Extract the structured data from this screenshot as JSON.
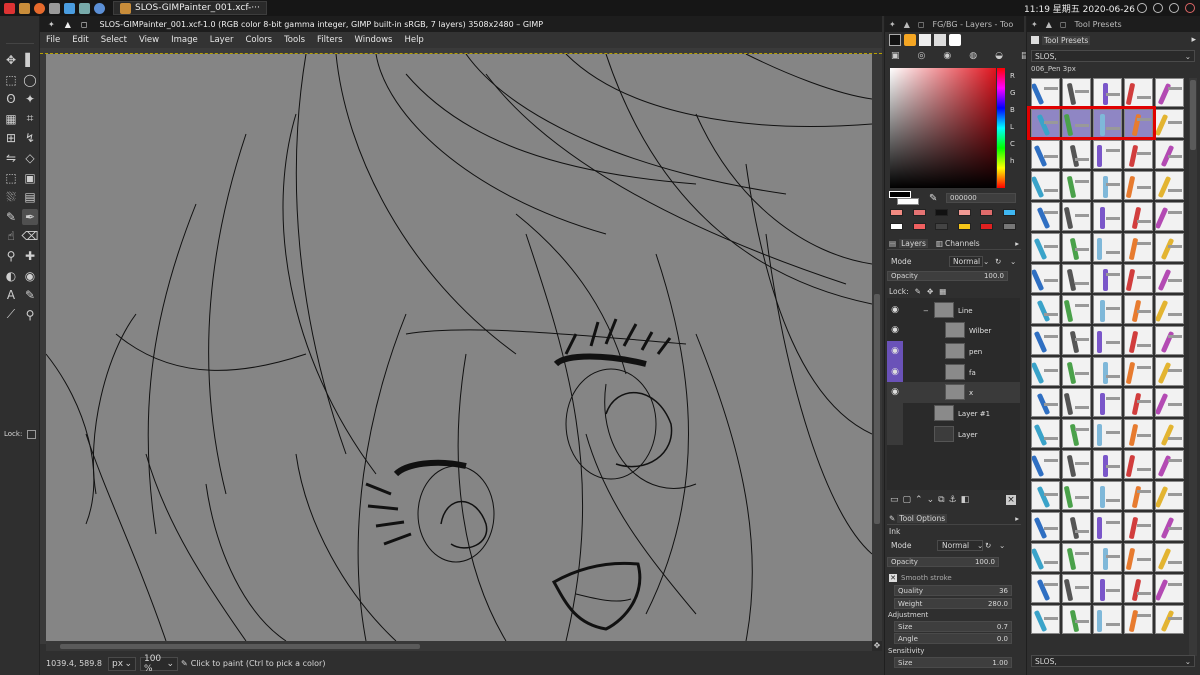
{
  "taskbar": {
    "window_button": "SLOS-GIMPainter_001.xcf-···",
    "clock": "11:19 星期五 2020-06-26"
  },
  "image_window": {
    "title": "SLOS-GIMPainter_001.xcf-1.0 (RGB color 8-bit gamma integer, GIMP built-in sRGB, 7 layers) 3508x2480 – GIMP",
    "menu": [
      "File",
      "Edit",
      "Select",
      "View",
      "Image",
      "Layer",
      "Colors",
      "Tools",
      "Filters",
      "Windows",
      "Help"
    ]
  },
  "toolbox": {
    "lock_label": "Lock:"
  },
  "status": {
    "coords": "1039.4, 589.8",
    "unit": "px",
    "zoom": "100 %",
    "message": "Click to paint (Ctrl to pick a color)"
  },
  "dock_left": {
    "title": "FG/BG - Layers - Too",
    "channels": [
      "R",
      "G",
      "B",
      "L",
      "C",
      "h"
    ],
    "hex_value": "000000",
    "history_swatches": [
      "#f28b82",
      "#e57373",
      "#111111",
      "#f19a94",
      "#e06b6b",
      "#3fb7f2",
      "#ffffff",
      "#f06060",
      "#444444",
      "#f5c518",
      "#e02020",
      "#777777"
    ],
    "layers_tab": "Layers",
    "channels_tab": "Channels",
    "mode_label": "Mode",
    "mode_value": "Normal",
    "opacity_label": "Opacity",
    "opacity_value": "100.0",
    "lock_label": "Lock:",
    "layers": [
      {
        "name": "Line"
      },
      {
        "name": "Wilber"
      },
      {
        "name": "pen"
      },
      {
        "name": "fa"
      },
      {
        "name": "x"
      },
      {
        "name": "Layer #1"
      },
      {
        "name": "Layer"
      }
    ],
    "tool_options_tab": "Tool Options",
    "tool_name": "Ink",
    "to_mode_label": "Mode",
    "to_mode_value": "Normal",
    "to_opacity_label": "Opacity",
    "to_opacity_value": "100.0",
    "smooth_stroke": "Smooth stroke",
    "quality_label": "Quality",
    "quality_value": "36",
    "weight_label": "Weight",
    "weight_value": "280.0",
    "adjustment_label": "Adjustment",
    "size_label": "Size",
    "size_value": "0.7",
    "angle_label": "Angle",
    "angle_value": "0.0",
    "sensitivity_label": "Sensitivity",
    "sens_size_label": "Size",
    "sens_size_value": "1.00"
  },
  "dock_right": {
    "title": "Tool Presets",
    "tab": "Tool Presets",
    "filter": "SLOS,",
    "preset_name": "006_Pen 3px",
    "bottom_filter": "SLOS,"
  },
  "colors": {
    "accent_highlight": "#e00000",
    "layer_eye_selected": "#6a52b8"
  }
}
